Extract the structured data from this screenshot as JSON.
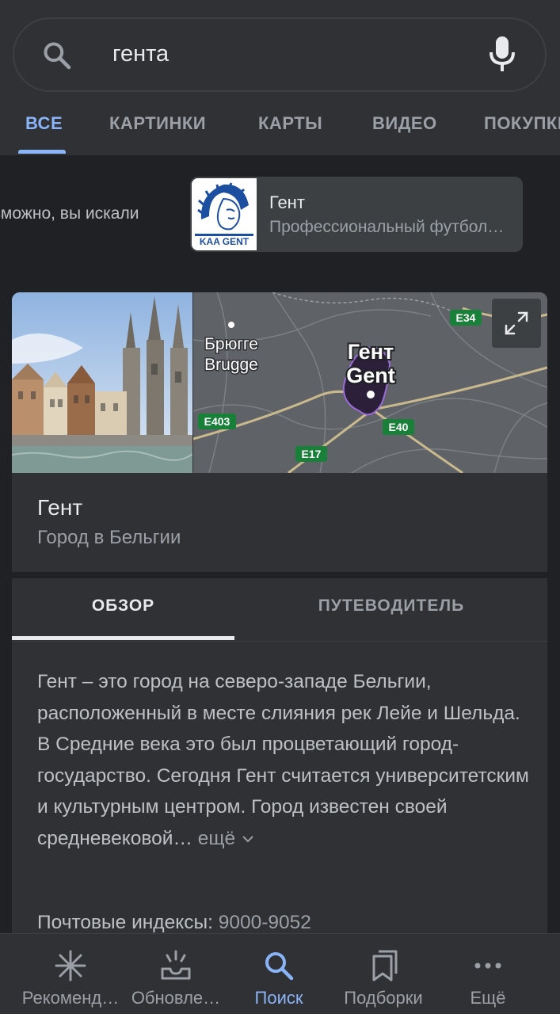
{
  "search": {
    "query": "гента"
  },
  "tabs": [
    {
      "label": "ВСЕ",
      "active": true
    },
    {
      "label": "КАРТИНКИ",
      "active": false
    },
    {
      "label": "КАРТЫ",
      "active": false
    },
    {
      "label": "ВИДЕО",
      "active": false
    },
    {
      "label": "ПОКУПКИ",
      "active": false
    }
  ],
  "did_you_mean": {
    "label": "вможно, вы искали",
    "card_title": "Гент",
    "card_subtitle": "Профессиональный футбольный клуб",
    "logo_text": "KAA GENT"
  },
  "map": {
    "city_ru": "Гент",
    "city_en": "Gent",
    "bruges_ru": "Брюгге",
    "bruges_en": "Brugge",
    "roads": [
      "E34",
      "E403",
      "E40",
      "E17"
    ]
  },
  "entity": {
    "title": "Гент",
    "subtitle": "Город в Бельгии"
  },
  "entity_tabs": {
    "overview": "ОБЗОР",
    "guide": "ПУТЕВОДИТЕЛЬ"
  },
  "description": {
    "text": "Гент – это город на северо-западе Бельгии, расположенный в месте слияния рек Лейе и Шельда. В Средние века это был процветающий город-государство. Сегодня Гент считается университетским и культурным центром. Город известен своей средневековой…",
    "more": " ещё"
  },
  "postal": {
    "label": "Почтовые индексы:",
    "value": " 9000-9052"
  },
  "bottom_nav": [
    {
      "label": "Рекоменд…",
      "icon": "asterisk-icon",
      "active": false
    },
    {
      "label": "Обновле…",
      "icon": "inbox-updates-icon",
      "active": false
    },
    {
      "label": "Поиск",
      "icon": "search-icon",
      "active": true
    },
    {
      "label": "Подборки",
      "icon": "collections-icon",
      "active": false
    },
    {
      "label": "Ещё",
      "icon": "more-dots-icon",
      "active": false
    }
  ],
  "colors": {
    "background": "#202124",
    "surface": "#303134",
    "accent": "#8ab4f8",
    "road_badge": "#188038"
  }
}
